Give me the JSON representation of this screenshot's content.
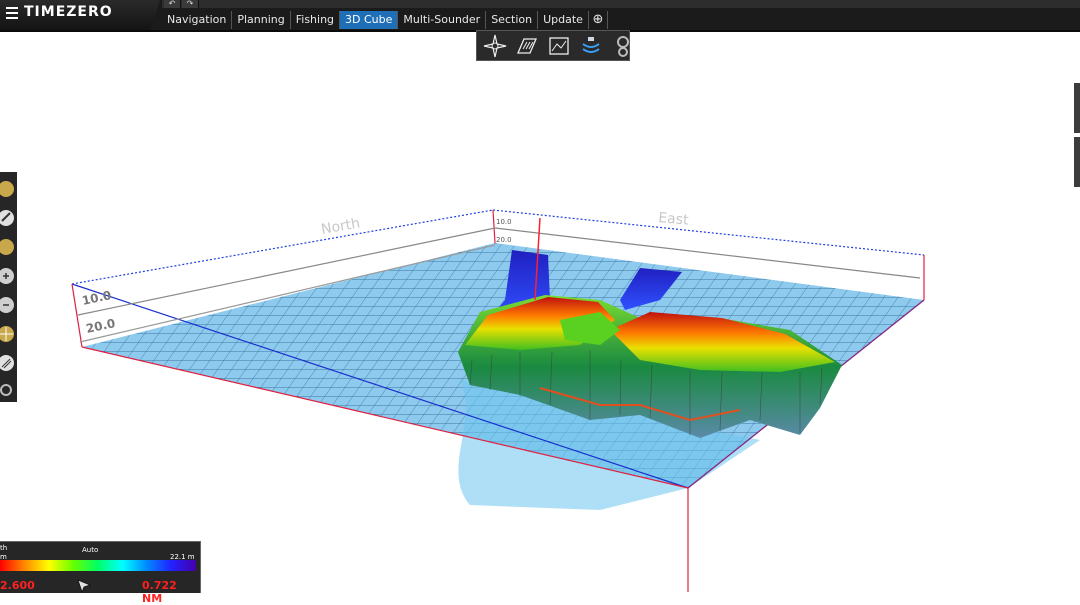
{
  "app": {
    "logo": "TIMEZERO"
  },
  "tabs": [
    {
      "label": "Navigation"
    },
    {
      "label": "Planning"
    },
    {
      "label": "Fishing"
    },
    {
      "label": "3D Cube"
    },
    {
      "label": "Multi-Sounder"
    },
    {
      "label": "Section"
    },
    {
      "label": "Update"
    }
  ],
  "tab_add": "⊕",
  "undo": {
    "undo": "↶",
    "redo": "↷"
  },
  "cube": {
    "axis_north": "North",
    "axis_east": "East",
    "left_ticks": [
      "10.0",
      "20.0"
    ],
    "back_ticks": [
      "10.0",
      "20.0"
    ]
  },
  "depth_panel": {
    "title_left": "th",
    "mode": "Auto",
    "unit_left": "m",
    "max_depth": "22.1 m",
    "left_value": "2.600",
    "right_value": "0.722 NM"
  },
  "colors": {
    "accent": "#1e6fb8",
    "topbar": "#1b1b1b"
  }
}
